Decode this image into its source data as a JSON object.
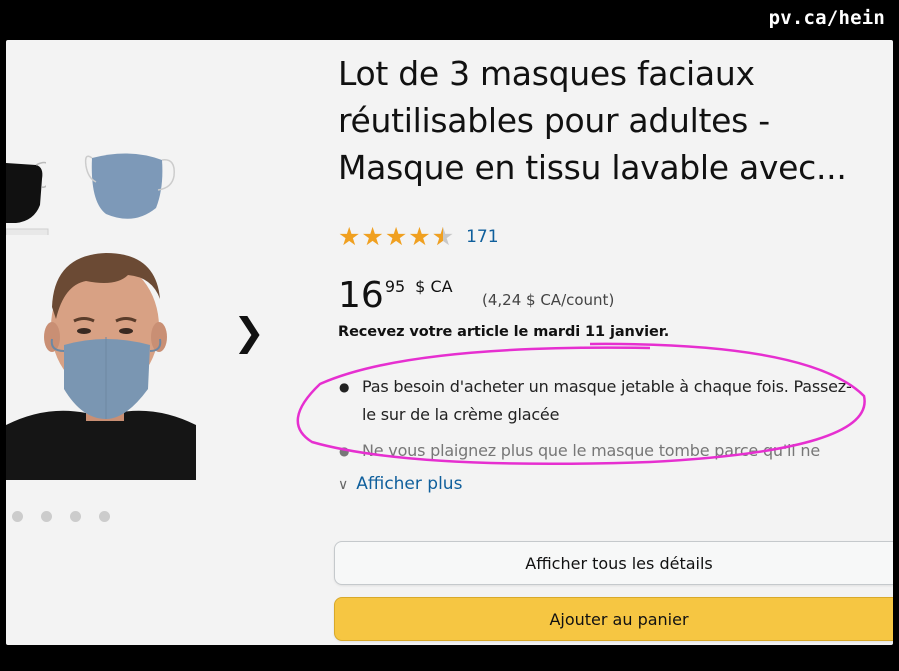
{
  "watermark": "pv.ca/hein",
  "product": {
    "title": "Lot de 3 masques faciaux réutilisables pour adultes - Masque en tissu lavable avec...",
    "rating": 4.5,
    "review_count": "171",
    "price": {
      "whole": "16",
      "fraction": "95",
      "currency": "$ CA"
    },
    "unit_price": "(4,24  $ CA/count)",
    "delivery": "Recevez votre article le mardi 11 janvier.",
    "bullets": [
      "Pas besoin d'acheter un masque jetable à chaque fois. Passez-le sur de la crème glacée",
      "Ne vous plaignez plus que le masque tombe parce qu'il ne"
    ],
    "show_more": "Afficher plus"
  },
  "buttons": {
    "details": "Afficher tous les détails",
    "add_to_cart": "Ajouter au panier"
  },
  "gallery": {
    "dot_count": 4
  },
  "colors": {
    "star": "#f0a020",
    "link": "#0f5f9c",
    "cart_button": "#f6c642",
    "annotation": "#e62fd0",
    "background": "#f3f3f3"
  },
  "icons": {
    "next": "chevron-right-icon",
    "show_more": "chevron-down-icon",
    "rating": "star-icon"
  }
}
